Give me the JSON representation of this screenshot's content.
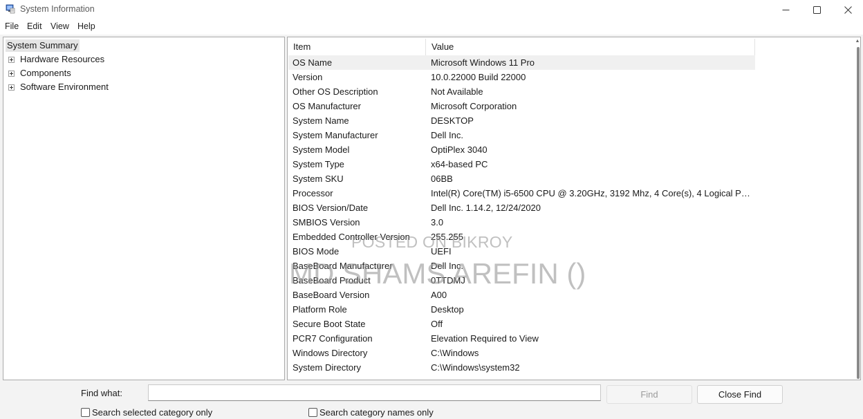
{
  "window": {
    "title": "System Information",
    "icon": "system-information-icon"
  },
  "menu": [
    "File",
    "Edit",
    "View",
    "Help"
  ],
  "tree": {
    "root": "System Summary",
    "children": [
      "Hardware Resources",
      "Components",
      "Software Environment"
    ]
  },
  "table": {
    "columns": [
      "Item",
      "Value"
    ],
    "rows": [
      {
        "item": "OS Name",
        "value": "Microsoft Windows 11 Pro"
      },
      {
        "item": "Version",
        "value": "10.0.22000 Build 22000"
      },
      {
        "item": "Other OS Description",
        "value": "Not Available"
      },
      {
        "item": "OS Manufacturer",
        "value": "Microsoft Corporation"
      },
      {
        "item": "System Name",
        "value": "DESKTOP"
      },
      {
        "item": "System Manufacturer",
        "value": "Dell Inc."
      },
      {
        "item": "System Model",
        "value": "OptiPlex 3040"
      },
      {
        "item": "System Type",
        "value": "x64-based PC"
      },
      {
        "item": "System SKU",
        "value": "06BB"
      },
      {
        "item": "Processor",
        "value": "Intel(R) Core(TM) i5-6500 CPU @ 3.20GHz, 3192 Mhz, 4 Core(s), 4 Logical Pro..."
      },
      {
        "item": "BIOS Version/Date",
        "value": "Dell Inc. 1.14.2, 12/24/2020"
      },
      {
        "item": "SMBIOS Version",
        "value": "3.0"
      },
      {
        "item": "Embedded Controller Version",
        "value": "255.255"
      },
      {
        "item": "BIOS Mode",
        "value": "UEFI"
      },
      {
        "item": "BaseBoard Manufacturer",
        "value": "Dell Inc."
      },
      {
        "item": "BaseBoard Product",
        "value": "0TTDMJ"
      },
      {
        "item": "BaseBoard Version",
        "value": "A00"
      },
      {
        "item": "Platform Role",
        "value": "Desktop"
      },
      {
        "item": "Secure Boot State",
        "value": "Off"
      },
      {
        "item": "PCR7 Configuration",
        "value": "Elevation Required to View"
      },
      {
        "item": "Windows Directory",
        "value": "C:\\Windows"
      },
      {
        "item": "System Directory",
        "value": "C:\\Windows\\system32"
      }
    ]
  },
  "watermark": {
    "line1": "POSTED ON BIKROY",
    "line2": "MD SHAMS AREFIN ()"
  },
  "find": {
    "label": "Find what:",
    "value": "",
    "find_button": "Find",
    "close_button": "Close Find",
    "option_selected_category": "Search selected category only",
    "option_category_names": "Search category names only"
  }
}
